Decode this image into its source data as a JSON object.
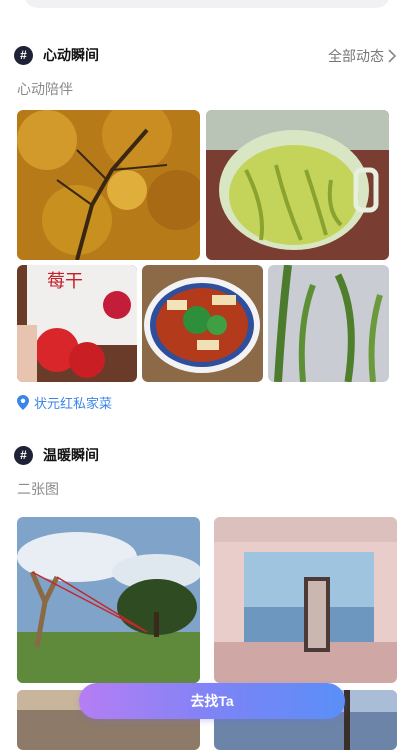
{
  "section1": {
    "title": "心动瞬间",
    "more_label": "全部动态",
    "subtitle": "心动陪伴",
    "location": "状元红私家菜",
    "photos": [
      {
        "subject": "autumn ginkgo tree"
      },
      {
        "subject": "green tea in glass cup"
      },
      {
        "subject": "strawberry snack bag"
      },
      {
        "subject": "bowl of vegetables and tofu"
      },
      {
        "subject": "green grass blades"
      }
    ]
  },
  "section2": {
    "title": "温暖瞬间",
    "subtitle": "二张图",
    "photos": [
      {
        "subject": "wooden slingshot art in field"
      },
      {
        "subject": "pink room with doorway mirror"
      },
      {
        "subject": "blurred photo"
      },
      {
        "subject": "coastal view"
      }
    ]
  },
  "cta": {
    "label": "去找Ta"
  },
  "icons": {
    "topic": "hash-icon",
    "more": "chevron-right-icon",
    "location": "location-pin-icon"
  },
  "colors": {
    "accent_blue": "#3a86e8",
    "cta_start": "#b67df4",
    "cta_end": "#5a8ff8"
  }
}
